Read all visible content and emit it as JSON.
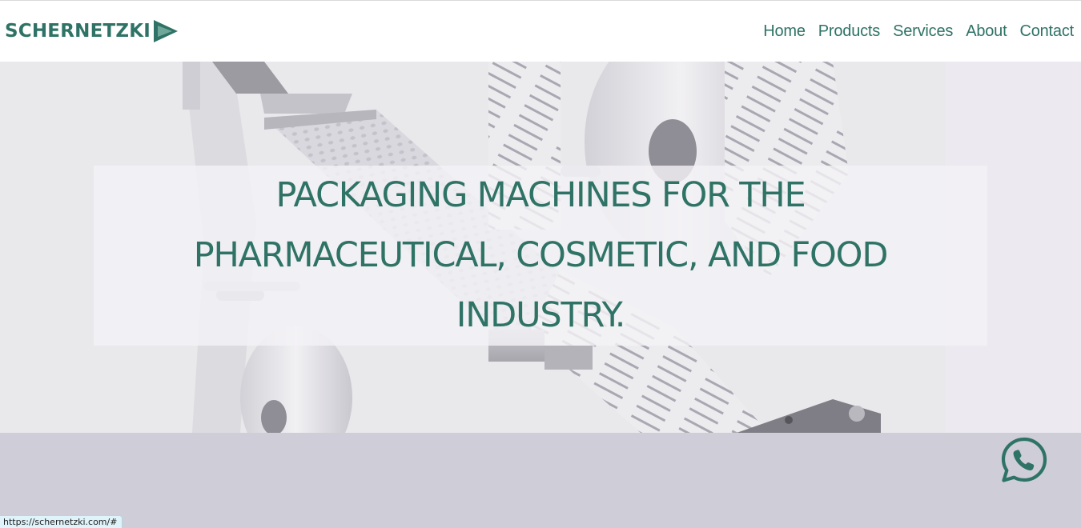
{
  "header": {
    "logo_text": "SCHERNETZKI",
    "nav": [
      {
        "label": "Home"
      },
      {
        "label": "Products"
      },
      {
        "label": "Services"
      },
      {
        "label": "About"
      },
      {
        "label": "Contact"
      }
    ]
  },
  "hero": {
    "headline": "PACKAGING MACHINES FOR THE PHARMACEUTICAL, COSMETIC, AND FOOD INDUSTRY."
  },
  "floating": {
    "icon": "whatsapp-icon"
  },
  "status_bar": {
    "url": "https://schernetzki.com/#"
  },
  "colors": {
    "brand_green": "#2f7366",
    "hero_bg": "#e9e8eb",
    "lower_band": "#cfcdd7",
    "status_bg": "#dff3fa"
  }
}
